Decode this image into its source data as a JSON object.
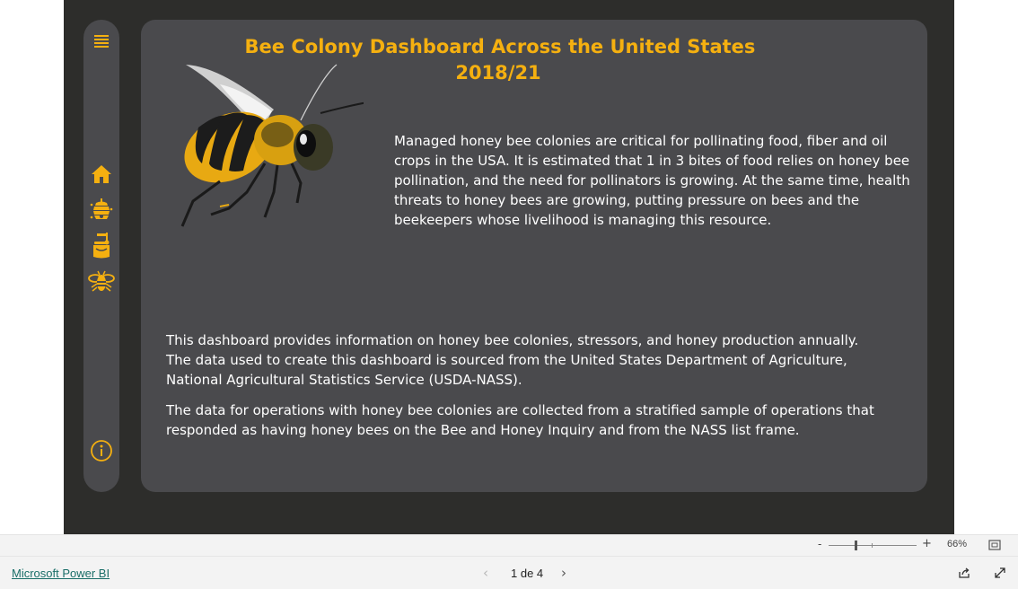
{
  "report": {
    "title": "Bee Colony Dashboard Across the United States",
    "year": "2018/21",
    "paragraph_1": "Managed honey bee colonies are critical for pollinating food, fiber and oil crops in the USA. It is estimated that 1 in 3 bites of food relies on honey bee pollination, and the need for pollinators is growing. At the same time, health threats to honey bees are growing, putting pressure on bees and the beekeepers whose livelihood is managing this resource.",
    "paragraph_2_line_1": "This dashboard provides information on honey bee colonies, stressors, and honey production annually.",
    "paragraph_2_line_2": "The data used to create this dashboard is sourced from the United States Department of Agriculture, National Agricultural Statistics Service (USDA-NASS).",
    "paragraph_3": "The data for operations with honey bee colonies are collected from a stratified sample of operations that responded as having honey bees on the Bee and Honey Inquiry and from the NASS list frame."
  },
  "nav": {
    "icons": [
      "menu-icon",
      "home-icon",
      "beehive-icon",
      "honey-jar-icon",
      "bee-icon",
      "info-icon"
    ]
  },
  "viewer": {
    "zoom_minus": "-",
    "zoom_plus": "+",
    "zoom_level": "66%",
    "zoom_fraction": 0.34,
    "brand_link": "Microsoft Power BI",
    "page_indicator": "1 de 4",
    "prev": "‹",
    "next": "›"
  },
  "colors": {
    "canvas_bg": "#2d2d2b",
    "panel_bg": "#4a4a4d",
    "accent_gold": "#f5b010",
    "body_text": "#ffffff"
  }
}
